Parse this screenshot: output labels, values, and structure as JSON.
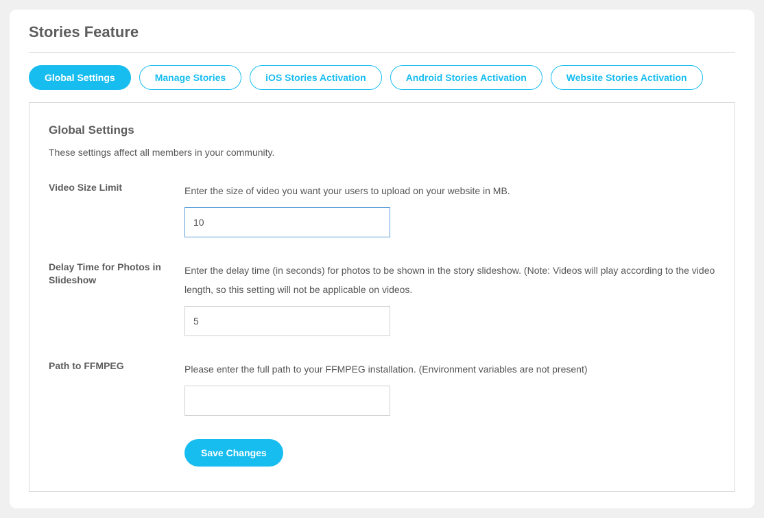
{
  "page_title": "Stories Feature",
  "tabs": [
    {
      "label": "Global Settings",
      "active": true
    },
    {
      "label": "Manage Stories",
      "active": false
    },
    {
      "label": "iOS Stories Activation",
      "active": false
    },
    {
      "label": "Android Stories Activation",
      "active": false
    },
    {
      "label": "Website Stories Activation",
      "active": false
    }
  ],
  "section": {
    "title": "Global Settings",
    "description": "These settings affect all members in your community."
  },
  "fields": {
    "video_size": {
      "label": "Video Size Limit",
      "help": "Enter the size of video you want your users to upload on your website in MB.",
      "value": "10"
    },
    "delay_time": {
      "label": "Delay Time for Photos in Slideshow",
      "help": "Enter the delay time (in seconds) for photos to be shown in the story slideshow. (Note: Videos will play according to the video length, so this setting will not be applicable on videos.",
      "value": "5"
    },
    "ffmpeg_path": {
      "label": "Path to FFMPEG",
      "help": "Please enter the full path to your FFMPEG installation. (Environment variables are not present)",
      "value": ""
    }
  },
  "submit_label": "Save Changes"
}
